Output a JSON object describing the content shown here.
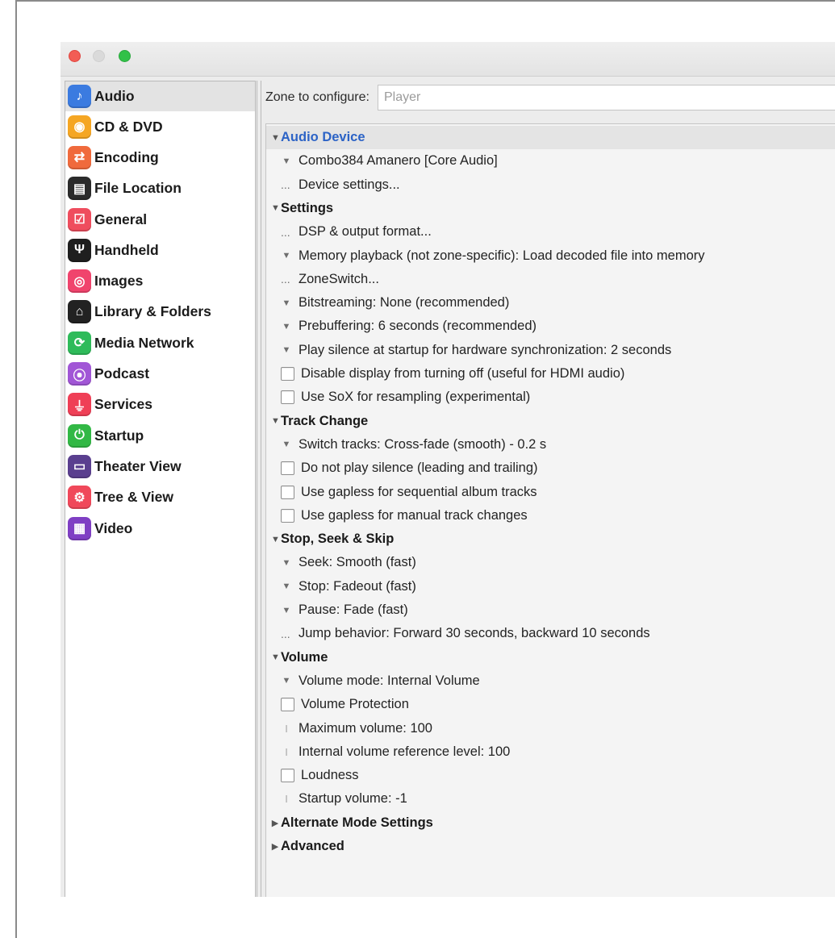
{
  "sidebar": {
    "items": [
      {
        "label": "Audio",
        "icon": "music-note-icon",
        "color": "#3b7be0",
        "glyph": "♪",
        "selected": true
      },
      {
        "label": "CD & DVD",
        "icon": "disc-icon",
        "color": "#f5a623",
        "glyph": "◉"
      },
      {
        "label": "Encoding",
        "icon": "encoding-arrows-icon",
        "color": "#f06a3c",
        "glyph": "⇄"
      },
      {
        "label": "File Location",
        "icon": "file-location-icon",
        "color": "#2b2b2b",
        "glyph": "▤"
      },
      {
        "label": "General",
        "icon": "checkbox-icon",
        "color": "#ef4d5e",
        "glyph": "☑"
      },
      {
        "label": "Handheld",
        "icon": "usb-icon",
        "color": "#1f1f1f",
        "glyph": "Ψ"
      },
      {
        "label": "Images",
        "icon": "camera-icon",
        "color": "#f0446d",
        "glyph": "◎"
      },
      {
        "label": "Library & Folders",
        "icon": "library-icon",
        "color": "#222222",
        "glyph": "⌂"
      },
      {
        "label": "Media Network",
        "icon": "network-icon",
        "color": "#2fbb5a",
        "glyph": "⟳"
      },
      {
        "label": "Podcast",
        "icon": "podcast-icon",
        "color": "#a156d6",
        "glyph": "⦿"
      },
      {
        "label": "Services",
        "icon": "plug-icon",
        "color": "#ef3f56",
        "glyph": "⏚"
      },
      {
        "label": "Startup",
        "icon": "power-icon",
        "color": "#32b845",
        "glyph": "⏻"
      },
      {
        "label": "Theater View",
        "icon": "monitor-icon",
        "color": "#5a3f8f",
        "glyph": "▭"
      },
      {
        "label": "Tree & View",
        "icon": "gear-icon",
        "color": "#f0485a",
        "glyph": "⚙"
      },
      {
        "label": "Video",
        "icon": "film-icon",
        "color": "#7f3fc4",
        "glyph": "▦"
      }
    ]
  },
  "zone": {
    "label": "Zone to configure:",
    "value": "Player"
  },
  "tree": {
    "rows": [
      {
        "kind": "section",
        "text": "Audio Device",
        "expanded": true,
        "active": true,
        "selected": true
      },
      {
        "kind": "dropdown",
        "text": "Combo384 Amanero [Core Audio]"
      },
      {
        "kind": "action",
        "text": "Device settings..."
      },
      {
        "kind": "section",
        "text": "Settings",
        "expanded": true
      },
      {
        "kind": "action",
        "text": "DSP & output format..."
      },
      {
        "kind": "dropdown",
        "text": "Memory playback (not zone-specific): Load decoded file into memory"
      },
      {
        "kind": "action",
        "text": "ZoneSwitch..."
      },
      {
        "kind": "dropdown",
        "text": "Bitstreaming: None (recommended)"
      },
      {
        "kind": "dropdown",
        "text": "Prebuffering: 6 seconds (recommended)"
      },
      {
        "kind": "dropdown",
        "text": "Play silence at startup for hardware synchronization: 2 seconds"
      },
      {
        "kind": "checkbox",
        "text": "Disable display from turning off (useful for HDMI audio)",
        "checked": false
      },
      {
        "kind": "checkbox",
        "text": "Use SoX for resampling (experimental)",
        "checked": false
      },
      {
        "kind": "section",
        "text": "Track Change",
        "expanded": true
      },
      {
        "kind": "dropdown",
        "text": "Switch tracks: Cross-fade (smooth) - 0.2 s"
      },
      {
        "kind": "checkbox",
        "text": "Do not play silence (leading and trailing)",
        "checked": false
      },
      {
        "kind": "checkbox",
        "text": "Use gapless for sequential album tracks",
        "checked": false
      },
      {
        "kind": "checkbox",
        "text": "Use gapless for manual track changes",
        "checked": false
      },
      {
        "kind": "section",
        "text": "Stop, Seek & Skip",
        "expanded": true
      },
      {
        "kind": "dropdown",
        "text": "Seek: Smooth (fast)"
      },
      {
        "kind": "dropdown",
        "text": "Stop: Fadeout (fast)"
      },
      {
        "kind": "dropdown",
        "text": "Pause: Fade (fast)"
      },
      {
        "kind": "action",
        "text": "Jump behavior: Forward 30 seconds, backward 10 seconds"
      },
      {
        "kind": "section",
        "text": "Volume",
        "expanded": true
      },
      {
        "kind": "dropdown",
        "text": "Volume mode: Internal Volume"
      },
      {
        "kind": "checkbox",
        "text": "Volume Protection",
        "checked": false
      },
      {
        "kind": "edit",
        "text": "Maximum volume: 100"
      },
      {
        "kind": "edit",
        "text": "Internal volume reference level: 100"
      },
      {
        "kind": "checkbox",
        "text": "Loudness",
        "checked": false
      },
      {
        "kind": "edit",
        "text": "Startup volume: -1"
      },
      {
        "kind": "section",
        "text": "Alternate Mode Settings",
        "expanded": false
      },
      {
        "kind": "section",
        "text": "Advanced",
        "expanded": false
      }
    ]
  }
}
